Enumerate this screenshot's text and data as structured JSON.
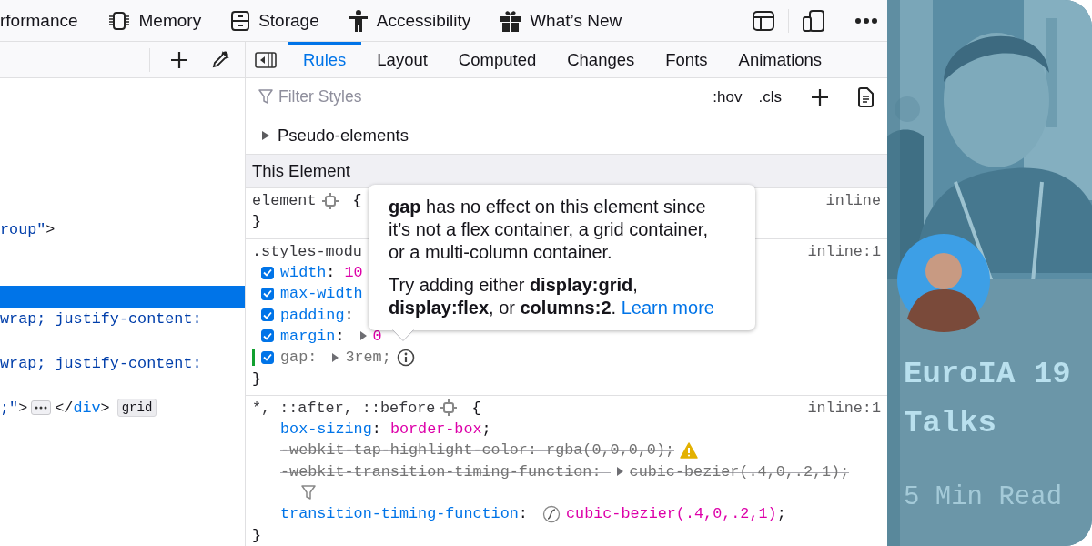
{
  "toolbar": {
    "tabs": [
      {
        "label": "rformance"
      },
      {
        "label": "Memory"
      },
      {
        "label": "Storage"
      },
      {
        "label": "Accessibility"
      },
      {
        "label": "What’s New"
      }
    ]
  },
  "markup": {
    "lines": [
      {
        "selected": false,
        "segments": [
          {
            "kind": "attr",
            "text": "roup\""
          },
          {
            "kind": "punct",
            "text": ">"
          }
        ]
      },
      {
        "selected": false
      },
      {
        "selected": false
      },
      {
        "selected": true
      },
      {
        "selected": false,
        "segments": [
          {
            "kind": "attr",
            "text": "wrap; justify-content:"
          }
        ]
      },
      {
        "selected": false
      },
      {
        "selected": false,
        "segments": [
          {
            "kind": "attr",
            "text": "wrap; justify-content:"
          }
        ]
      },
      {
        "selected": false
      },
      {
        "selected": false,
        "segments": [
          {
            "kind": "attr",
            "text": ";\""
          },
          {
            "kind": "punct",
            "text": ">"
          },
          {
            "kind": "ellipsis"
          },
          {
            "kind": "punct",
            "text": "</"
          },
          {
            "kind": "tag",
            "text": "div"
          },
          {
            "kind": "punct",
            "text": ">"
          },
          {
            "kind": "badge",
            "text": "grid"
          }
        ]
      }
    ]
  },
  "sidebar_tabs": [
    {
      "label": "Rules",
      "selected": true
    },
    {
      "label": "Layout",
      "selected": false
    },
    {
      "label": "Computed",
      "selected": false
    },
    {
      "label": "Changes",
      "selected": false
    },
    {
      "label": "Fonts",
      "selected": false
    },
    {
      "label": "Animations",
      "selected": false
    }
  ],
  "filter": {
    "placeholder": "Filter Styles",
    "toggles": [
      ":hov",
      ".cls"
    ]
  },
  "pseudo_elements": {
    "label": "Pseudo-elements",
    "expanded": false
  },
  "section_header": "This Element",
  "rules": [
    {
      "selector": [
        {
          "kind": "sel",
          "text": "element"
        },
        {
          "kind": "node"
        },
        {
          "kind": "punct",
          "text": "{"
        }
      ],
      "source": "inline",
      "close": "}"
    },
    {
      "selector": [
        {
          "kind": "sel",
          "text": ".styles-modu"
        }
      ],
      "source": "inline:1",
      "close": "}",
      "lines": [
        {
          "kind": "declaration",
          "checked": true,
          "changed": false,
          "inactive": false,
          "overridden": false,
          "segments": [
            {
              "kind": "prop",
              "text": "width"
            },
            {
              "kind": "punct",
              "text": ":"
            },
            {
              "kind": "value",
              "text": "10"
            }
          ]
        },
        {
          "kind": "declaration",
          "checked": true,
          "changed": false,
          "inactive": false,
          "overridden": false,
          "segments": [
            {
              "kind": "prop",
              "text": "max-width"
            }
          ]
        },
        {
          "kind": "declaration",
          "checked": true,
          "changed": false,
          "inactive": false,
          "overridden": false,
          "segments": [
            {
              "kind": "prop",
              "text": "padding"
            },
            {
              "kind": "punct",
              "text": ":"
            }
          ]
        },
        {
          "kind": "declaration",
          "checked": true,
          "changed": false,
          "inactive": false,
          "overridden": false,
          "segments": [
            {
              "kind": "prop",
              "text": "margin"
            },
            {
              "kind": "punct",
              "text": ":"
            },
            {
              "kind": "expander"
            },
            {
              "kind": "value",
              "text": "0"
            }
          ]
        },
        {
          "kind": "declaration",
          "checked": true,
          "changed": true,
          "inactive": true,
          "overridden": false,
          "segments": [
            {
              "kind": "prop",
              "text": "gap"
            },
            {
              "kind": "punct",
              "text": ":"
            },
            {
              "kind": "expander"
            },
            {
              "kind": "value",
              "text": "3rem"
            },
            {
              "kind": "punct",
              "text": ";"
            },
            {
              "kind": "info"
            }
          ]
        }
      ]
    },
    {
      "selector": [
        {
          "kind": "sel",
          "text": "*, ::after, ::before"
        },
        {
          "kind": "node"
        },
        {
          "kind": "punct",
          "text": "{"
        }
      ],
      "source": "inline:1",
      "close": "}",
      "lines": [
        {
          "kind": "declaration",
          "overridden": false,
          "segments": [
            {
              "kind": "prop",
              "text": "box-sizing"
            },
            {
              "kind": "punct",
              "text": ":"
            },
            {
              "kind": "value",
              "text": "border-box"
            },
            {
              "kind": "punct",
              "text": ";"
            }
          ]
        },
        {
          "kind": "declaration",
          "overridden": true,
          "segments": [
            {
              "kind": "prop",
              "text": "-webkit-tap-highlight-color"
            },
            {
              "kind": "punct",
              "text": ":"
            },
            {
              "kind": "value",
              "text": "rgba(0,0,0,0)"
            },
            {
              "kind": "punct",
              "text": ";"
            },
            {
              "kind": "warning"
            }
          ]
        },
        {
          "kind": "declaration",
          "overridden": true,
          "segments": [
            {
              "kind": "prop",
              "text": "-webkit-transition-timing-function"
            },
            {
              "kind": "punct",
              "text": ":"
            },
            {
              "kind": "expander"
            },
            {
              "kind": "value",
              "text": "cubic-bezier(.4,0,.2,1)"
            },
            {
              "kind": "punct",
              "text": ";"
            }
          ]
        },
        {
          "kind": "note",
          "segments": [
            {
              "kind": "filter"
            }
          ]
        },
        {
          "kind": "declaration",
          "overridden": false,
          "segments": [
            {
              "kind": "prop",
              "text": "transition-timing-function"
            },
            {
              "kind": "punct",
              "text": ":"
            },
            {
              "kind": "timing"
            },
            {
              "kind": "value",
              "text": "cubic-bezier(.4,0,.2,1)"
            },
            {
              "kind": "punct",
              "text": ";"
            }
          ]
        }
      ]
    }
  ],
  "tooltip": {
    "paragraphs": [
      {
        "text": "**gap** has no effect on this element since it’s not a flex container, a grid container, or a multi-column container."
      },
      {
        "text": "Try adding either **display:grid**, **display:flex**, or **columns:2**.",
        "link": "Learn more"
      }
    ]
  },
  "preview": {
    "kind": "picture",
    "title_lines": [
      "EuroIA 19",
      "Talks"
    ],
    "meta": "5 Min Read"
  }
}
